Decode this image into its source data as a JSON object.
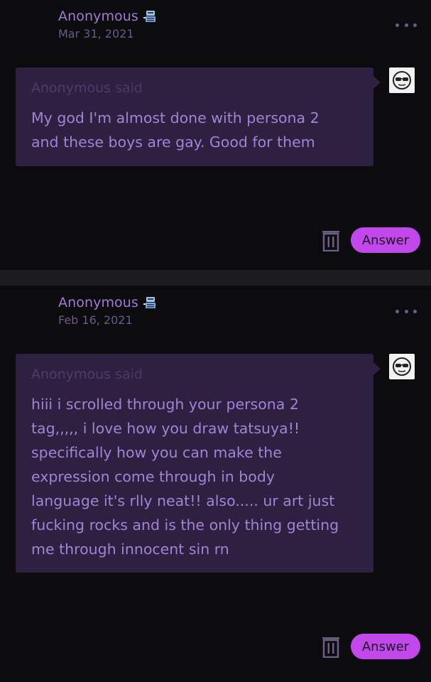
{
  "asks": [
    {
      "author": "Anonymous",
      "date": "Mar 31, 2021",
      "said_author": "Anonymous",
      "said_word": "said",
      "message": "My god I'm almost done with persona 2\nand these boys are gay. Good for them",
      "answer_label": "Answer",
      "icons": {
        "author_badge": "robot-icon",
        "avatar": "sunglasses-face-icon",
        "delete": "trash-icon",
        "menu": "more-icon"
      }
    },
    {
      "author": "Anonymous",
      "date": "Feb 16, 2021",
      "said_author": "Anonymous",
      "said_word": "said",
      "message": "hiii i scrolled through your persona 2\ntag,,,,, i love how you draw tatsuya!!\nspecifically how you can make the\nexpression come through in body\nlanguage it's rlly neat!! also..... ur art just\nfucking rocks and is the only thing getting\nme through innocent sin rn",
      "answer_label": "Answer",
      "icons": {
        "author_badge": "robot-icon",
        "avatar": "sunglasses-face-icon",
        "delete": "trash-icon",
        "menu": "more-icon"
      }
    }
  ],
  "colors": {
    "accent": "#c348ec",
    "bubble": "#2e2040",
    "background": "#0c0b0d",
    "text": "#a283d4"
  }
}
